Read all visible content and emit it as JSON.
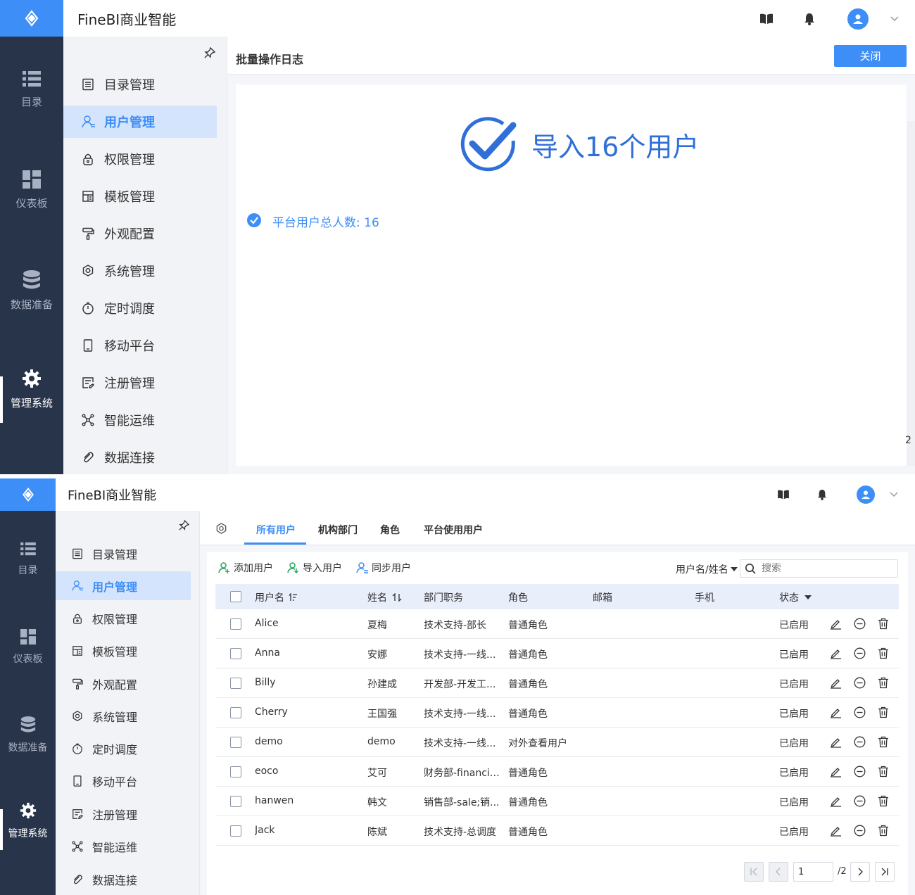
{
  "app": {
    "brand": "FineBI商业智能"
  },
  "rail": {
    "items": [
      {
        "label": "目录",
        "icon": "list-icon"
      },
      {
        "label": "仪表板",
        "icon": "dashboard-icon"
      },
      {
        "label": "数据准备",
        "icon": "database-icon"
      },
      {
        "label": "管理系统",
        "icon": "gear-icon"
      }
    ]
  },
  "menu": {
    "items": [
      {
        "label": "目录管理",
        "icon": "catalog-icon"
      },
      {
        "label": "用户管理",
        "icon": "user-icon"
      },
      {
        "label": "权限管理",
        "icon": "lock-icon"
      },
      {
        "label": "模板管理",
        "icon": "template-icon"
      },
      {
        "label": "外观配置",
        "icon": "brush-icon"
      },
      {
        "label": "系统管理",
        "icon": "settings-icon"
      },
      {
        "label": "定时调度",
        "icon": "timer-icon"
      },
      {
        "label": "移动平台",
        "icon": "mobile-icon"
      },
      {
        "label": "注册管理",
        "icon": "register-icon"
      },
      {
        "label": "智能运维",
        "icon": "ops-icon"
      },
      {
        "label": "数据连接",
        "icon": "link-icon"
      }
    ]
  },
  "log": {
    "title": "批量操作日志",
    "close_label": "关闭",
    "result": "导入16个用户",
    "detail": "平台用户总人数: 16",
    "side_num": "2"
  },
  "users": {
    "tabs": [
      "所有用户",
      "机构部门",
      "角色",
      "平台使用用户"
    ],
    "actions": [
      "添加用户",
      "导入用户",
      "同步用户"
    ],
    "filter_label": "用户名/姓名",
    "search_placeholder": "搜索",
    "columns": [
      "用户名",
      "姓名",
      "部门职务",
      "角色",
      "邮箱",
      "手机",
      "状态"
    ],
    "rows": [
      {
        "username": "Alice",
        "name": "夏梅",
        "dept": "技术支持-部长",
        "role": "普通角色",
        "status": "已启用"
      },
      {
        "username": "Anna",
        "name": "安娜",
        "dept": "技术支持-一线...",
        "role": "普通角色",
        "status": "已启用"
      },
      {
        "username": "Billy",
        "name": "孙建成",
        "dept": "开发部-开发工...",
        "role": "普通角色",
        "status": "已启用"
      },
      {
        "username": "Cherry",
        "name": "王国强",
        "dept": "技术支持-一线...",
        "role": "普通角色",
        "status": "已启用"
      },
      {
        "username": "demo",
        "name": "demo",
        "dept": "技术支持-一线...",
        "role": "对外查看用户",
        "status": "已启用"
      },
      {
        "username": "eoco",
        "name": "艾可",
        "dept": "财务部-financial...",
        "role": "普通角色",
        "status": "已启用"
      },
      {
        "username": "hanwen",
        "name": "韩文",
        "dept": "销售部-sale;销...",
        "role": "普通角色",
        "status": "已启用"
      },
      {
        "username": "Jack",
        "name": "陈斌",
        "dept": "技术支持-总调度",
        "role": "普通角色",
        "status": "已启用"
      }
    ],
    "pager": {
      "current": "1",
      "total": "/2"
    }
  }
}
